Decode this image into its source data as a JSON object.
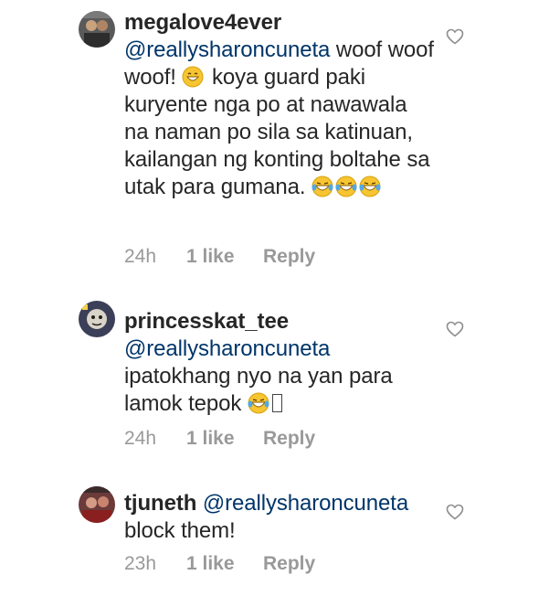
{
  "comments": [
    {
      "username": "megalove4ever",
      "mention": "@reallysharoncuneta",
      "text_parts": [
        " woof woof woof! ",
        " koya guard paki kuryente nga po at nawawala na naman po sila sa katinuan, kailangan ng konting boltahe sa utak para gumana. "
      ],
      "time": "24h",
      "likes": "1 like",
      "reply": "Reply"
    },
    {
      "username": "princesskat_tee",
      "mention": "@reallysharoncuneta",
      "text_parts": [
        "ipatokhang nyo na yan para lamok tepok "
      ],
      "time": "24h",
      "likes": "1 like",
      "reply": "Reply"
    },
    {
      "username": "tjuneth",
      "mention": "@reallysharoncuneta",
      "text_parts": [
        "block them!"
      ],
      "time": "23h",
      "likes": "1 like",
      "reply": "Reply"
    }
  ],
  "colors": {
    "mention": "#003569",
    "meta": "#999999",
    "text": "#262626"
  },
  "icons": [
    "avatar",
    "grinning-emoji",
    "laughing-tears-emoji",
    "heart-outline-icon"
  ]
}
